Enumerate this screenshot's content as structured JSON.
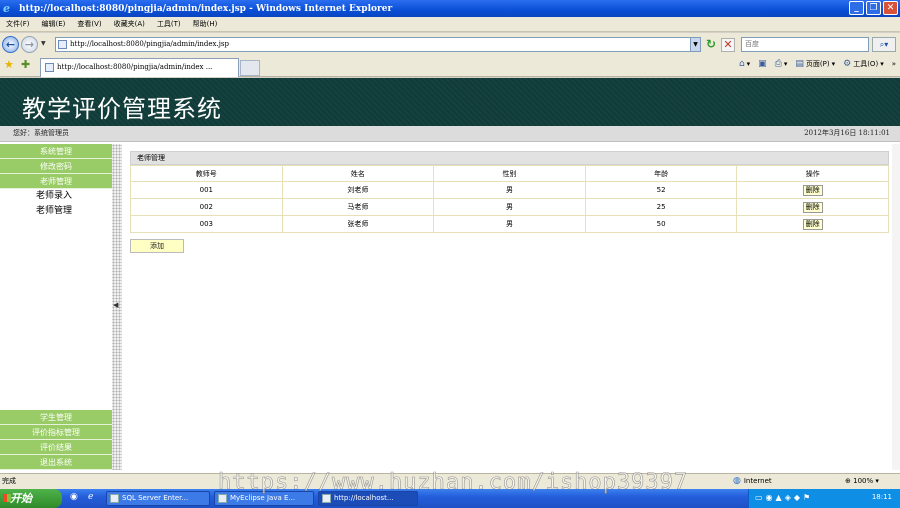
{
  "window": {
    "title": "http://localhost:8080/pingjia/admin/index.jsp - Windows Internet Explorer"
  },
  "menubar": [
    "文件(F)",
    "编辑(E)",
    "查看(V)",
    "收藏夹(A)",
    "工具(T)",
    "帮助(H)"
  ],
  "address": {
    "url": "http://localhost:8080/pingjia/admin/index.jsp",
    "search_placeholder": "百度"
  },
  "tab": {
    "label": "http://localhost:8080/pingjia/admin/index ..."
  },
  "commandbar": {
    "page": "页面(P)",
    "tools": "工具(O)"
  },
  "app": {
    "title": "教学评价管理系统",
    "greeting": "您好：系统管理员",
    "datetime": "2012年3月16日  18:11:01"
  },
  "sidebar": {
    "top": [
      "系统管理",
      "修改密码",
      "老师管理"
    ],
    "sub": [
      "老师录入",
      "老师管理"
    ],
    "bottom": [
      "学生管理",
      "评价指标管理",
      "评价结果",
      "退出系统"
    ]
  },
  "main": {
    "panel_title": "老师管理",
    "columns": [
      "教师号",
      "姓名",
      "性别",
      "年龄",
      "操作"
    ],
    "rows": [
      {
        "id": "001",
        "name": "刘老师",
        "gender": "男",
        "age": "52",
        "action": "删除"
      },
      {
        "id": "002",
        "name": "马老师",
        "gender": "男",
        "age": "25",
        "action": "删除"
      },
      {
        "id": "003",
        "name": "张老师",
        "gender": "男",
        "age": "50",
        "action": "删除"
      }
    ],
    "add_label": "添加"
  },
  "statusbar": {
    "text": "完成",
    "zone": "Internet",
    "zoom": "100%"
  },
  "taskbar": {
    "start": "开始",
    "tasks": [
      "SQL Server Enter...",
      "MyEclipse Java E...",
      "http://localhost..."
    ],
    "clock": "18:11"
  },
  "watermark": "https://www.huzhan.com/ishop39397"
}
